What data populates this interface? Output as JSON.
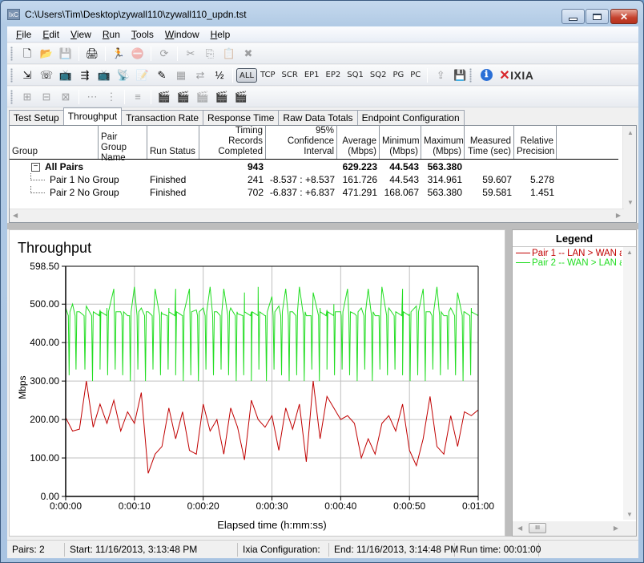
{
  "window": {
    "title": "C:\\Users\\Tim\\Desktop\\zywall110\\zywall110_updn.tst",
    "app_icon_label": "IxC",
    "controls": {
      "minimize": "minimize",
      "maximize": "maximize",
      "close": "✕"
    }
  },
  "menu": [
    {
      "label": "File",
      "accel": "F"
    },
    {
      "label": "Edit",
      "accel": "E"
    },
    {
      "label": "View",
      "accel": "V"
    },
    {
      "label": "Run",
      "accel": "R"
    },
    {
      "label": "Tools",
      "accel": "T"
    },
    {
      "label": "Window",
      "accel": "W"
    },
    {
      "label": "Help",
      "accel": "H"
    }
  ],
  "toolbar1": {
    "icons": [
      "new-file-icon",
      "open-folder-icon",
      "save-icon",
      "print-icon",
      "run-icon",
      "stop-icon",
      "refresh-icon",
      "cut-icon",
      "copy-icon",
      "paste-icon",
      "delete-icon"
    ],
    "glyphs": [
      "🗋",
      "📂",
      "💾",
      "🖨",
      "🏃",
      "⛔",
      "⟳",
      "✂",
      "⎘",
      "📋",
      "✖"
    ]
  },
  "toolbar2": {
    "icons": [
      "add-pair-icon",
      "add-voice-pair-icon",
      "add-video-pair-icon",
      "add-multicast-icon",
      "edit-video-icon",
      "broadcast-video-icon",
      "edit-script-icon",
      "edit-endpoint-icon",
      "edit-grid-icon",
      "swap-icon",
      "pair-fraction-icon"
    ],
    "glyphs": [
      "⇲",
      "☏",
      "📺",
      "⇶",
      "📺",
      "📡",
      "📝",
      "✎",
      "▦",
      "⇄",
      "½"
    ],
    "protocols": [
      "ALL",
      "TCP",
      "SCR",
      "EP1",
      "EP2",
      "SQ1",
      "SQ2",
      "PG",
      "PC"
    ],
    "active_protocol": "ALL",
    "extra_icons": [
      "export-icon",
      "save-results-icon",
      "info-icon"
    ],
    "brand": "IXIA"
  },
  "toolbar3": {
    "icons": [
      "group-1-icon",
      "group-2-icon",
      "group-3-icon",
      "ungroup-1-icon",
      "ungroup-2-icon",
      "list-icon",
      "clapper-icon",
      "clapper-green-icon",
      "clapper-red-icon",
      "network-clapper-icon",
      "phone-clapper-icon"
    ],
    "glyphs": [
      "⊞",
      "⊟",
      "⊠",
      "⋯",
      "⋮",
      "≡",
      "🎬",
      "🎬",
      "🎬",
      "🎬",
      "🎬"
    ]
  },
  "tabs": [
    "Test Setup",
    "Throughput",
    "Transaction Rate",
    "Response Time",
    "Raw Data Totals",
    "Endpoint Configuration"
  ],
  "active_tab": "Throughput",
  "grid": {
    "columns": [
      {
        "label": "Group",
        "line2": ""
      },
      {
        "label": "Pair Group",
        "line2": "Name"
      },
      {
        "label": "Run Status",
        "line2": ""
      },
      {
        "label": "Timing Records",
        "line2": "Completed"
      },
      {
        "label": "95% Confidence",
        "line2": "Interval"
      },
      {
        "label": "Average",
        "line2": "(Mbps)"
      },
      {
        "label": "Minimum",
        "line2": "(Mbps)"
      },
      {
        "label": "Maximum",
        "line2": "(Mbps)"
      },
      {
        "label": "Measured",
        "line2": "Time (sec)"
      },
      {
        "label": "Relative",
        "line2": "Precision"
      }
    ],
    "summary": {
      "group": "All Pairs",
      "expander": "−",
      "records": "943",
      "average": "629.223",
      "minimum": "44.543",
      "maximum": "563.380"
    },
    "rows": [
      {
        "pair": "Pair 1",
        "group_name": "No Group",
        "status": "Finished",
        "records": "241",
        "ci": "-8.537 : +8.537",
        "average": "161.726",
        "minimum": "44.543",
        "maximum": "314.961",
        "time": "59.607",
        "precision": "5.278"
      },
      {
        "pair": "Pair 2",
        "group_name": "No Group",
        "status": "Finished",
        "records": "702",
        "ci": "-6.837 : +6.837",
        "average": "471.291",
        "minimum": "168.067",
        "maximum": "563.380",
        "time": "59.581",
        "precision": "1.451"
      }
    ]
  },
  "legend": {
    "title": "Legend",
    "items": [
      {
        "label": "Pair 1 -- LAN > WAN a",
        "color": "#c00000"
      },
      {
        "label": "Pair 2 -- WAN > LAN a",
        "color": "#22dd22"
      }
    ],
    "scroll_thumb": "III"
  },
  "chart_data": {
    "type": "line",
    "title": "Throughput",
    "xlabel": "Elapsed time (h:mm:ss)",
    "ylabel": "Mbps",
    "ylim": [
      0,
      598.5
    ],
    "xlim_seconds": [
      0,
      60
    ],
    "yticks": [
      "0.00",
      "100.00",
      "200.00",
      "300.00",
      "400.00",
      "500.00",
      "598.50"
    ],
    "ytick_values": [
      0,
      100,
      200,
      300,
      400,
      500,
      598.5
    ],
    "xticks": [
      "0:00:00",
      "0:00:10",
      "0:00:20",
      "0:00:30",
      "0:00:40",
      "0:00:50",
      "0:01:00"
    ],
    "xtick_values": [
      0,
      10,
      20,
      30,
      40,
      50,
      60
    ],
    "grid": true,
    "series": [
      {
        "name": "Pair 1 -- LAN > WAN",
        "color": "#c00000",
        "x": [
          0,
          1,
          2,
          3,
          4,
          5,
          6,
          7,
          8,
          9,
          10,
          11,
          12,
          13,
          14,
          15,
          16,
          17,
          18,
          19,
          20,
          21,
          22,
          23,
          24,
          25,
          26,
          27,
          28,
          29,
          30,
          31,
          32,
          33,
          34,
          35,
          36,
          37,
          38,
          39,
          40,
          41,
          42,
          43,
          44,
          45,
          46,
          47,
          48,
          49,
          50,
          51,
          52,
          53,
          54,
          55,
          56,
          57,
          58,
          59,
          60
        ],
        "y": [
          205,
          170,
          175,
          300,
          180,
          240,
          190,
          250,
          170,
          220,
          190,
          270,
          60,
          110,
          130,
          230,
          150,
          220,
          120,
          110,
          240,
          170,
          200,
          110,
          230,
          180,
          95,
          250,
          200,
          180,
          210,
          120,
          230,
          175,
          240,
          90,
          300,
          150,
          260,
          230,
          200,
          210,
          190,
          100,
          150,
          110,
          190,
          210,
          170,
          240,
          120,
          80,
          150,
          260,
          130,
          110,
          210,
          130,
          220,
          210,
          225
        ]
      },
      {
        "name": "Pair 2 -- WAN > LAN",
        "color": "#22dd22",
        "x": [
          0,
          1,
          2,
          3,
          4,
          5,
          6,
          7,
          8,
          9,
          10,
          11,
          12,
          13,
          14,
          15,
          16,
          17,
          18,
          19,
          20,
          21,
          22,
          23,
          24,
          25,
          26,
          27,
          28,
          29,
          30,
          31,
          32,
          33,
          34,
          35,
          36,
          37,
          38,
          39,
          40,
          41,
          42,
          43,
          44,
          45,
          46,
          47,
          48,
          49,
          50,
          51,
          52,
          53,
          54,
          55,
          56,
          57,
          58,
          59,
          60
        ],
        "y": [
          490,
          500,
          480,
          495,
          470,
          485,
          490,
          540,
          480,
          470,
          545,
          490,
          480,
          540,
          475,
          490,
          540,
          470,
          540,
          485,
          490,
          545,
          480,
          540,
          490,
          475,
          530,
          480,
          545,
          470,
          520,
          495,
          540,
          480,
          545,
          470,
          530,
          490,
          485,
          500,
          480,
          540,
          475,
          490,
          540,
          470,
          545,
          490,
          480,
          540,
          475,
          495,
          540,
          480,
          545,
          470,
          490,
          530,
          480,
          490,
          470
        ],
        "dips": [
          0.5,
          1.5,
          2.8,
          3.9,
          5.0,
          6.1,
          7.2,
          8.3,
          9.4,
          10.5,
          11.6,
          12.7,
          13.8,
          14.9,
          16.0,
          17.1,
          18.2,
          19.3,
          20.4,
          21.5,
          22.6,
          23.7,
          24.8,
          25.9,
          27.0,
          28.1,
          29.2,
          30.3,
          31.4,
          32.5,
          33.6,
          34.7,
          35.8,
          36.9,
          38.0,
          39.1,
          40.2,
          41.3,
          42.4,
          43.5,
          44.6,
          45.7,
          46.8,
          47.9,
          49.0,
          50.1,
          51.2,
          52.3,
          53.4,
          54.5,
          55.6,
          56.7,
          57.8,
          58.9
        ],
        "dip_value": 300
      }
    ]
  },
  "status": {
    "pairs": "Pairs: 2",
    "start": "Start: 11/16/2013, 3:13:48 PM",
    "config": "Ixia Configuration:",
    "end": "End: 11/16/2013, 3:14:48 PM",
    "runtime": "Run time: 00:01:00"
  }
}
